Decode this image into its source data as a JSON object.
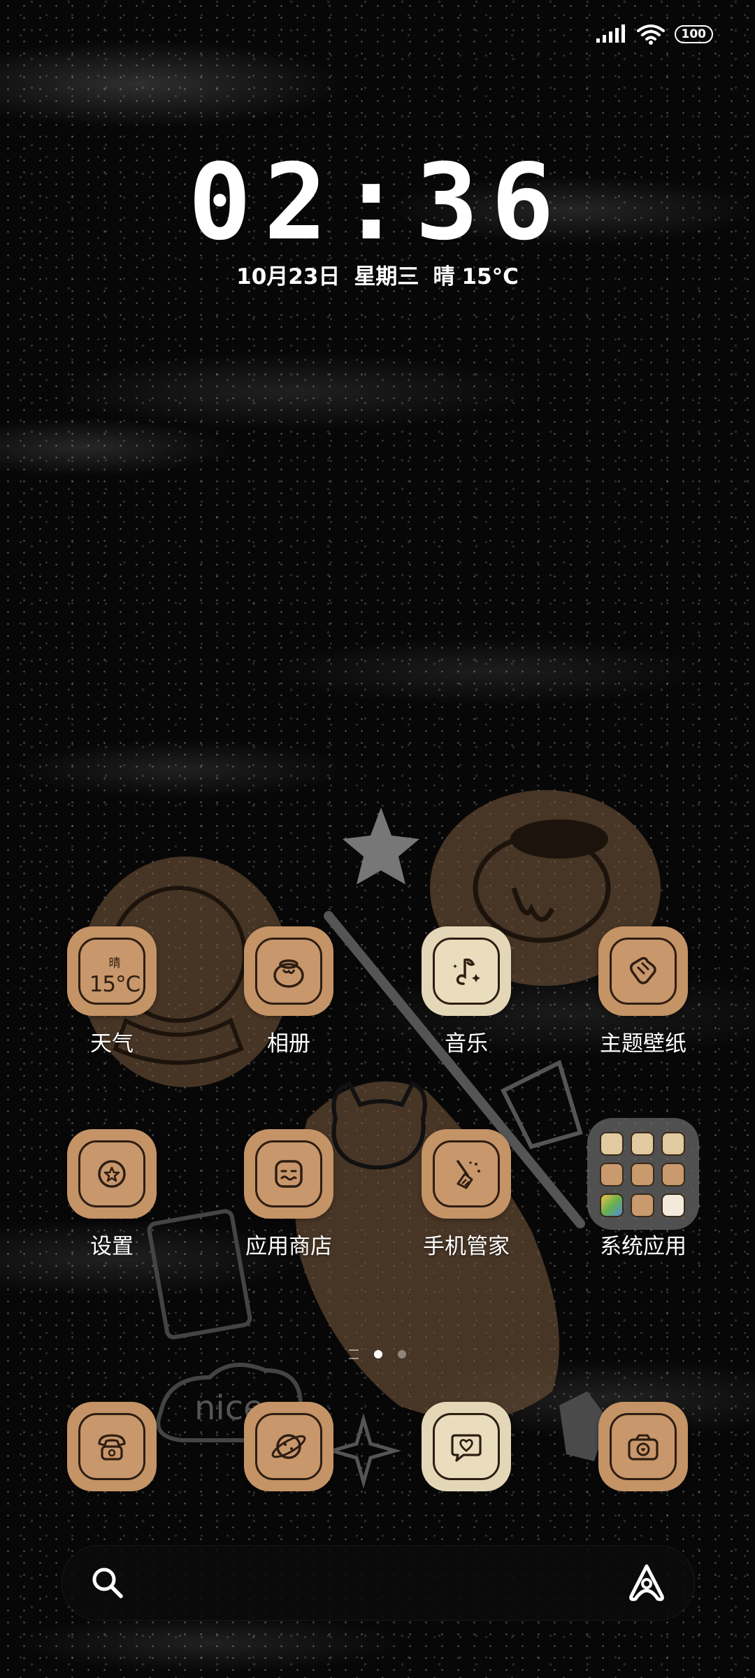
{
  "status_bar": {
    "battery_level": "100",
    "icons": [
      "signal-icon",
      "wifi-icon",
      "battery-icon"
    ]
  },
  "lock_clock": {
    "time": "02:36",
    "date": "10月23日",
    "weekday": "星期三",
    "weather": "晴",
    "temperature": "15°C"
  },
  "apps_row1": [
    {
      "label": "天气",
      "icon": "weather-icon",
      "style": "brown",
      "widget_condition": "晴",
      "widget_temp": "15°C"
    },
    {
      "label": "相册",
      "icon": "honey-pot-icon",
      "style": "brown"
    },
    {
      "label": "音乐",
      "icon": "music-note-icon",
      "style": "cream"
    },
    {
      "label": "主题壁纸",
      "icon": "paw-hand-icon",
      "style": "brown"
    }
  ],
  "apps_row2": [
    {
      "label": "设置",
      "icon": "star-gear-icon",
      "style": "brown"
    },
    {
      "label": "应用商店",
      "icon": "smile-box-icon",
      "style": "brown"
    },
    {
      "label": "手机管家",
      "icon": "broom-icon",
      "style": "brown"
    },
    {
      "label": "系统应用",
      "icon": "folder-icon",
      "style": "folder"
    }
  ],
  "pager": {
    "pages": 2,
    "current": 1
  },
  "dock": [
    {
      "icon": "phone-icon",
      "style": "brown"
    },
    {
      "icon": "browser-planet-icon",
      "style": "brown"
    },
    {
      "icon": "messages-heart-icon",
      "style": "cream"
    },
    {
      "icon": "camera-icon",
      "style": "brown"
    }
  ],
  "search_bar": {
    "left_icon": "search-icon",
    "right_icon": "assistant-icon"
  },
  "colors": {
    "icon_brown": "#c49366",
    "icon_cream": "#e4d7b7",
    "icon_outline": "#2e1e12",
    "background": "#070707"
  }
}
